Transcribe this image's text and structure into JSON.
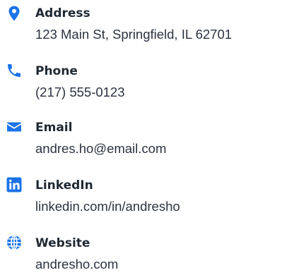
{
  "accent_color": "#1a73e8",
  "contacts": [
    {
      "icon": "map-pin-icon",
      "label": "Address",
      "value": "123 Main St, Springfield, IL 62701"
    },
    {
      "icon": "phone-icon",
      "label": "Phone",
      "value": "(217) 555-0123"
    },
    {
      "icon": "envelope-icon",
      "label": "Email",
      "value": "andres.ho@email.com"
    },
    {
      "icon": "linkedin-icon",
      "label": "LinkedIn",
      "value": "linkedin.com/in/andresho"
    },
    {
      "icon": "globe-icon",
      "label": "Website",
      "value": "andresho.com"
    }
  ]
}
